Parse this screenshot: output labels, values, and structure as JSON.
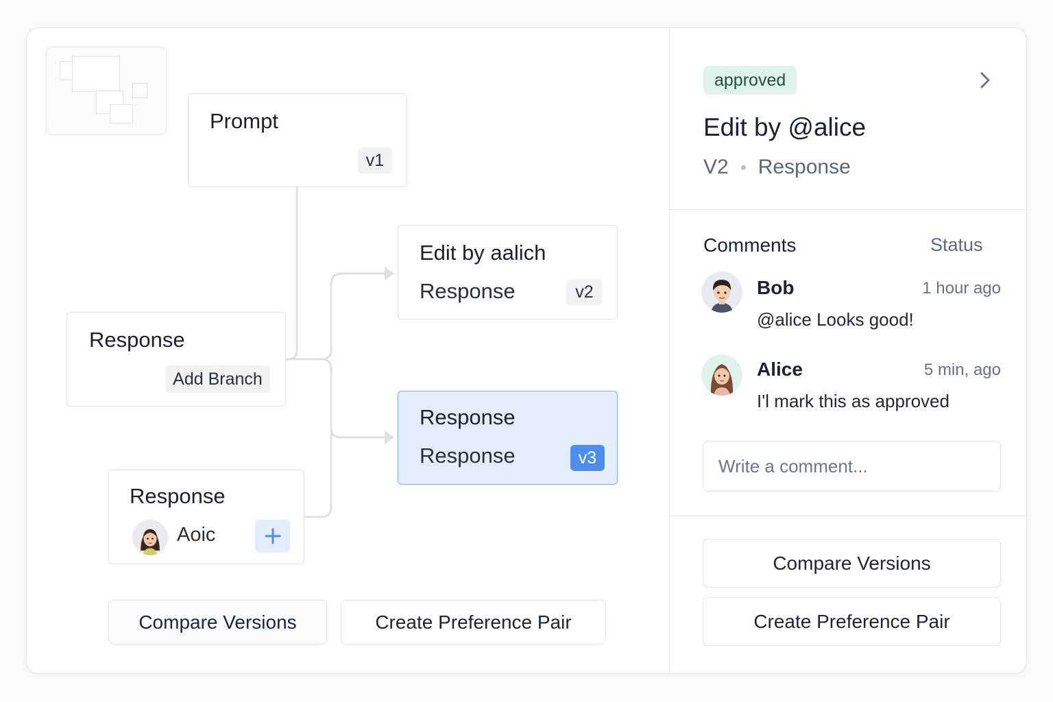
{
  "tree": {
    "prompt_node": {
      "title": "Prompt",
      "version": "v1"
    },
    "edit_node": {
      "title": "Edit by aalich",
      "subtitle": "Response",
      "version": "v2"
    },
    "branch_node": {
      "title": "Response",
      "action_label": "Add Branch"
    },
    "selected_node": {
      "title": "Response",
      "subtitle": "Response",
      "version": "v3"
    },
    "user_node": {
      "title": "Response",
      "author": "Aoic",
      "add_icon": "plus-icon"
    }
  },
  "canvas_actions": {
    "compare_label": "Compare Versions",
    "preference_label": "Create Preference Pair"
  },
  "panel": {
    "status_badge": "approved",
    "title": "Edit by @alice",
    "version": "V2",
    "type": "Response",
    "comments_header": "Comments",
    "status_header": "Status",
    "comments": [
      {
        "author": "Bob",
        "time": "1 hour ago",
        "text": "@alice Looks good!"
      },
      {
        "author": "Alice",
        "time": "5 min, ago",
        "text": "I'l mark this as approved"
      }
    ],
    "comment_placeholder": "Write a comment...",
    "compare_label": "Compare Versions",
    "preference_label": "Create Preference Pair"
  },
  "colors": {
    "accent": "#4d8df0",
    "selected_bg": "#e3edfc",
    "approved_bg": "#dff3ea"
  }
}
